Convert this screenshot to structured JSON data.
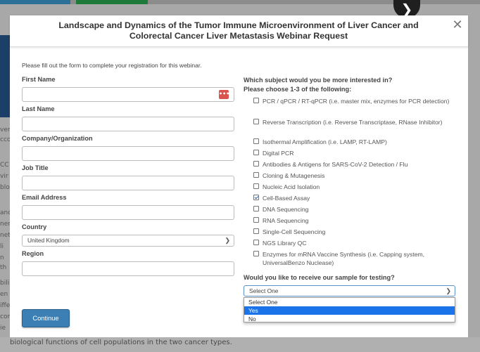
{
  "background": {
    "arrow": "❯",
    "bottom_text": "biological functions of cell populations in the two cancer types.",
    "left_fragments": [
      "ver",
      "cco",
      "CC",
      "vir",
      "blo",
      "and",
      "ner",
      "net",
      "li",
      "n th",
      "bili",
      "en",
      "iffe",
      "con",
      "ie"
    ]
  },
  "modal": {
    "title_line1": "Landscape and Dynamics of the Tumor Immune Microenvironment of Liver Cancer and",
    "title_line2": "Colorectal Cancer Liver Metastasis Webinar Request",
    "close_glyph": "✕",
    "intro": "Please fill out the form to complete your registration for this webinar.",
    "fields": {
      "first_name": {
        "label": "First Name",
        "value": ""
      },
      "last_name": {
        "label": "Last Name",
        "value": ""
      },
      "company": {
        "label": "Company/Organization",
        "value": ""
      },
      "job_title": {
        "label": "Job Title",
        "value": ""
      },
      "email": {
        "label": "Email Address",
        "value": ""
      },
      "country": {
        "label": "Country",
        "value": "United Kingdom"
      },
      "region": {
        "label": "Region",
        "value": ""
      }
    },
    "autofill_icon": "•••",
    "continue_label": "Continue",
    "subjects": {
      "question_line1": "Which subject would you be more interested in?",
      "question_line2": "Please choose 1-3 of the following:",
      "options": [
        {
          "label": "PCR / qPCR / RT-qPCR (i.e. master mix, enzymes for PCR detection)",
          "checked": false
        },
        {
          "label": "Reverse Transcription (i.e. Reverse Transcriptase, RNase Inhibitor)",
          "checked": false
        },
        {
          "label": "Isothermal Amplification (i.e. LAMP, RT-LAMP)",
          "checked": false
        },
        {
          "label": "Digital PCR",
          "checked": false
        },
        {
          "label": "Antibodies & Antigens for SARS-CoV-2 Detection / Flu",
          "checked": false
        },
        {
          "label": "Cloning & Mutagenesis",
          "checked": false
        },
        {
          "label": "Nucleic Acid Isolation",
          "checked": false
        },
        {
          "label": "Cell-Based Assay",
          "checked": true
        },
        {
          "label": "DNA Sequencing",
          "checked": false
        },
        {
          "label": "RNA Sequencing",
          "checked": false
        },
        {
          "label": "Single-Cell Sequencing",
          "checked": false
        },
        {
          "label": "NGS Library QC",
          "checked": false
        },
        {
          "label": "Enzymes for mRNA Vaccine Synthesis (i.e. Capping system, UniversalBenzo Nuclease)",
          "checked": false
        }
      ]
    },
    "sample": {
      "question": "Would you like to receive our sample for testing?",
      "selected": "Select One",
      "options": [
        "Select One",
        "Yes",
        "No"
      ],
      "highlighted": "Yes"
    }
  }
}
